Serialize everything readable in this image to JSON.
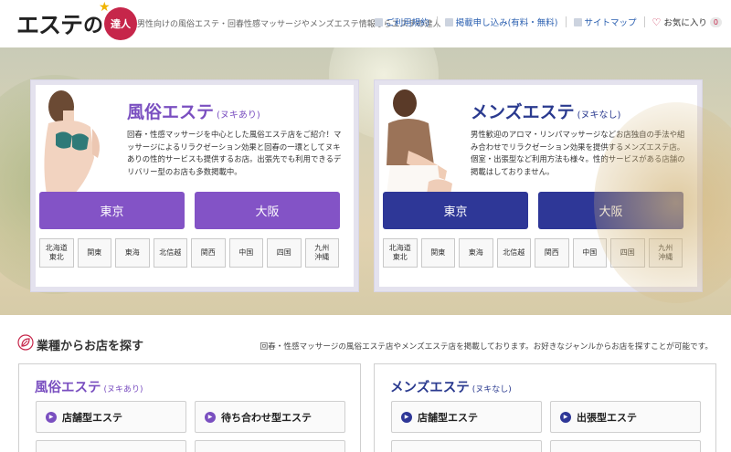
{
  "header": {
    "logo_main": "エステ",
    "logo_no": "の",
    "logo_seal": "達人",
    "tagline": "男性向けの風俗エステ・回春性感マッサージやメンズエステ情報ならエステの達人",
    "nav": [
      {
        "label": "ご利用規約"
      },
      {
        "label": "掲載申し込み(有料・無料)"
      },
      {
        "label": "サイトマップ"
      }
    ],
    "favorites": {
      "label": "お気に入り",
      "count": "0"
    }
  },
  "cards": {
    "fuzoku": {
      "title": "風俗エステ",
      "subtitle": "(ヌキあり)",
      "description": "回春・性感マッサージを中心とした風俗エステ店をご紹介！マッサージによるリラクゼーション効果と回春の一環としてヌキありの性的サービスも提供するお店。出張先でも利用できるデリバリー型のお店も多数掲載中。",
      "cities": [
        "東京",
        "大阪"
      ],
      "regions": [
        "北海道\n東北",
        "関東",
        "東海",
        "北信越",
        "関西",
        "中国",
        "四国",
        "九州\n沖縄"
      ]
    },
    "mens": {
      "title": "メンズエステ",
      "subtitle": "(ヌキなし)",
      "description": "男性歓迎のアロマ・リンパマッサージなどお店独自の手法や組み合わせでリラクゼーション効果を提供するメンズエステ店。個室・出張型など利用方法も様々。性的サービスがある店舗の掲載はしておりません。",
      "cities": [
        "東京",
        "大阪"
      ],
      "regions": [
        "北海道\n東北",
        "関東",
        "東海",
        "北信越",
        "関西",
        "中国",
        "四国",
        "九州\n沖縄"
      ]
    }
  },
  "search_section": {
    "title": "業種からお店を探す",
    "note": "回春・性感マッサージの風俗エステ店やメンズエステ店を掲載しております。お好きなジャンルからお店を探すことが可能です。",
    "panels": {
      "fuzoku": {
        "title": "風俗エステ",
        "subtitle": "(ヌキあり)",
        "buttons": [
          "店舗型エステ",
          "待ち合わせ型エステ"
        ]
      },
      "mens": {
        "title": "メンズエステ",
        "subtitle": "(ヌキなし)",
        "buttons": [
          "店舗型エステ",
          "出張型エステ"
        ]
      }
    }
  },
  "colors": {
    "fuzoku_accent": "#8353c6",
    "mens_accent": "#2e3797",
    "brand_red": "#c6264a"
  }
}
